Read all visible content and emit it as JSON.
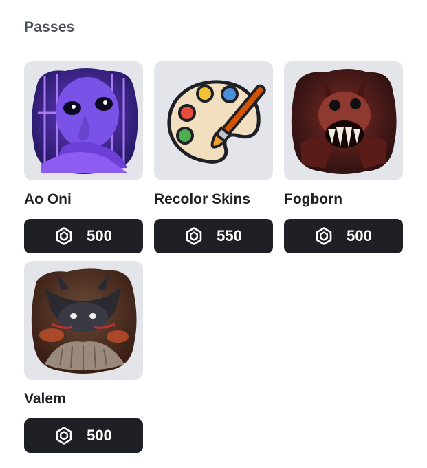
{
  "section": {
    "title": "Passes"
  },
  "passes": [
    {
      "name": "Ao Oni",
      "price": "500",
      "image_icon": "ao-oni-character-image",
      "price_icon": "robux-icon"
    },
    {
      "name": "Recolor Skins",
      "price": "550",
      "image_icon": "paint-palette-image",
      "price_icon": "robux-icon"
    },
    {
      "name": "Fogborn",
      "price": "500",
      "image_icon": "fogborn-monster-image",
      "price_icon": "robux-icon"
    },
    {
      "name": "Valem",
      "price": "500",
      "image_icon": "valem-creature-image",
      "price_icon": "robux-icon"
    }
  ],
  "colors": {
    "button_bg": "#1f2025",
    "thumb_bg": "#e4e5ea",
    "title_text": "#4e525c",
    "text": "#1f2025"
  }
}
